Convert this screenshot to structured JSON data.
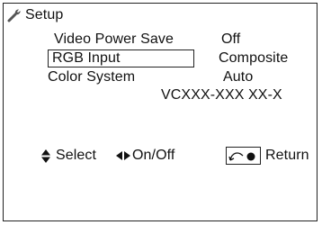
{
  "menu": {
    "title": "Setup",
    "title_icon": "wrench-icon",
    "items": [
      {
        "label": "Video Power Save",
        "value": "Off"
      },
      {
        "label": "RGB Input",
        "value": "Composite",
        "selected": true
      },
      {
        "label": "Color System",
        "value": "Auto"
      }
    ],
    "model": "VCXXX-XXX XX-X"
  },
  "footer": {
    "select_label": "Select",
    "select_icon": "up-down-arrow-icon",
    "onoff_label": "On/Off",
    "onoff_icon": "left-right-arrow-icon",
    "return_label": "Return",
    "return_icon": "return-key-icon"
  }
}
